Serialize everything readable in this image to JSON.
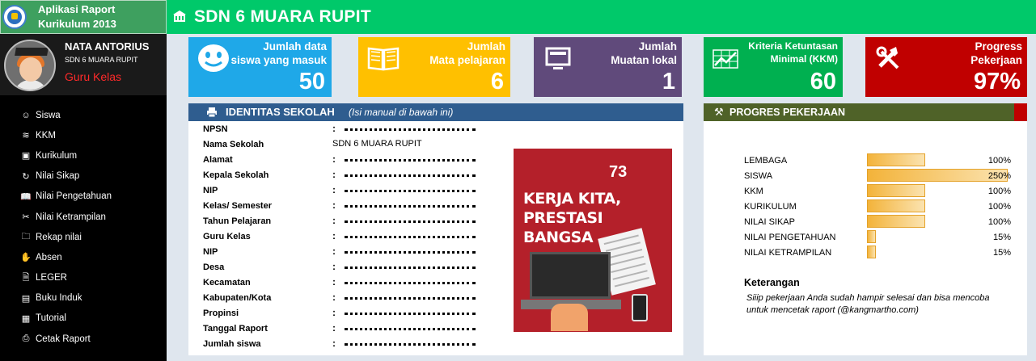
{
  "app": {
    "title_line1": "Aplikasi Raport",
    "title_line2": "Kurikulum 2013"
  },
  "header": {
    "title": "SDN 6 MUARA RUPIT",
    "icon": "school-icon",
    "color": "#00c96a"
  },
  "user": {
    "name": "NATA ANTORIUS",
    "school": "SDN 6 MUARA RUPIT",
    "role": "Guru Kelas"
  },
  "sidebar": {
    "items": [
      {
        "label": "Siswa",
        "icon": "smiley-icon",
        "glyph": "☺"
      },
      {
        "label": "KKM",
        "icon": "wave-icon",
        "glyph": "≋"
      },
      {
        "label": "Kurikulum",
        "icon": "monitor-icon",
        "glyph": "▣"
      },
      {
        "label": "Nilai Sikap",
        "icon": "refresh-icon",
        "glyph": "↻"
      },
      {
        "label": "Nilai Pengetahuan",
        "icon": "book-icon",
        "glyph": "📖"
      },
      {
        "label": "Nilai Ketrampilan",
        "icon": "tools-icon",
        "glyph": "✂"
      },
      {
        "label": "Rekap nilai",
        "icon": "folder-icon",
        "glyph": "🗀"
      },
      {
        "label": "Absen",
        "icon": "hand-icon",
        "glyph": "✋"
      },
      {
        "label": "LEGER",
        "icon": "document-icon",
        "glyph": "🗎"
      },
      {
        "label": "Buku Induk",
        "icon": "file-icon",
        "glyph": "▤"
      },
      {
        "label": "Tutorial",
        "icon": "computer-icon",
        "glyph": "▦"
      },
      {
        "label": "Cetak Raport",
        "icon": "printer-icon",
        "glyph": "⎙"
      }
    ]
  },
  "cards": [
    {
      "label_line1": "Jumlah data",
      "label_line2": "siswa yang masuk",
      "value": "50",
      "icon": "smiley-icon",
      "color": "#1fa8e8"
    },
    {
      "label_line1": "Jumlah",
      "label_line2": "Mata pelajaran",
      "value": "6",
      "icon": "book-icon",
      "color": "#ffc000"
    },
    {
      "label_line1": "Jumlah",
      "label_line2": "Muatan lokal",
      "value": "1",
      "icon": "monitor-icon",
      "color": "#604a7b"
    },
    {
      "label_line1": "Kriteria Ketuntasan",
      "label_line2": "Minimal (KKM)",
      "value": "60",
      "icon": "chart-icon",
      "color": "#00b050"
    },
    {
      "label_line1": "Progress",
      "label_line2": "Pekerjaan",
      "value": "97%",
      "icon": "tools-icon",
      "color": "#c00000"
    }
  ],
  "identitas": {
    "title": "IDENTITAS SEKOLAH",
    "note": "(Isi manual di bawah ini)",
    "fields": [
      {
        "label": "NPSN",
        "value": ""
      },
      {
        "label": "Nama Sekolah",
        "value": "SDN 6 MUARA RUPIT"
      },
      {
        "label": "Alamat",
        "value": ""
      },
      {
        "label": "Kepala Sekolah",
        "value": ""
      },
      {
        "label": "NIP",
        "value": ""
      },
      {
        "label": "Kelas/ Semester",
        "value": ""
      },
      {
        "label": "Tahun Pelajaran",
        "value": ""
      },
      {
        "label": "Guru Kelas",
        "value": ""
      },
      {
        "label": "NIP",
        "value": ""
      },
      {
        "label": "Desa",
        "value": ""
      },
      {
        "label": "Kecamatan",
        "value": ""
      },
      {
        "label": "Kabupaten/Kota",
        "value": ""
      },
      {
        "label": "Propinsi",
        "value": ""
      },
      {
        "label": "Tanggal Raport",
        "value": ""
      },
      {
        "label": "Jumlah siswa",
        "value": ""
      }
    ],
    "poster": {
      "logo": "73",
      "line1": "KERJA KITA,",
      "line2": "PRESTASI BANGSA"
    }
  },
  "progres": {
    "title": "PROGRES PEKERJAAN",
    "rows": [
      {
        "label": "LEMBAGA",
        "percent_text": "100%",
        "fill": 1.0
      },
      {
        "label": "SISWA",
        "percent_text": "250%",
        "fill": 2.5
      },
      {
        "label": "KKM",
        "percent_text": "100%",
        "fill": 1.0
      },
      {
        "label": "KURIKULUM",
        "percent_text": "100%",
        "fill": 1.0
      },
      {
        "label": "NILAI SIKAP",
        "percent_text": "100%",
        "fill": 1.0
      },
      {
        "label": "NILAI PENGETAHUAN",
        "percent_text": "15%",
        "fill": 0.15
      },
      {
        "label": "NILAI KETRAMPILAN",
        "percent_text": "15%",
        "fill": 0.15
      }
    ],
    "keterangan_title": "Keterangan",
    "keterangan_text": "Siiip pekerjaan Anda sudah hampir selesai dan bisa mencoba untuk mencetak raport (@kangmartho.com)"
  }
}
